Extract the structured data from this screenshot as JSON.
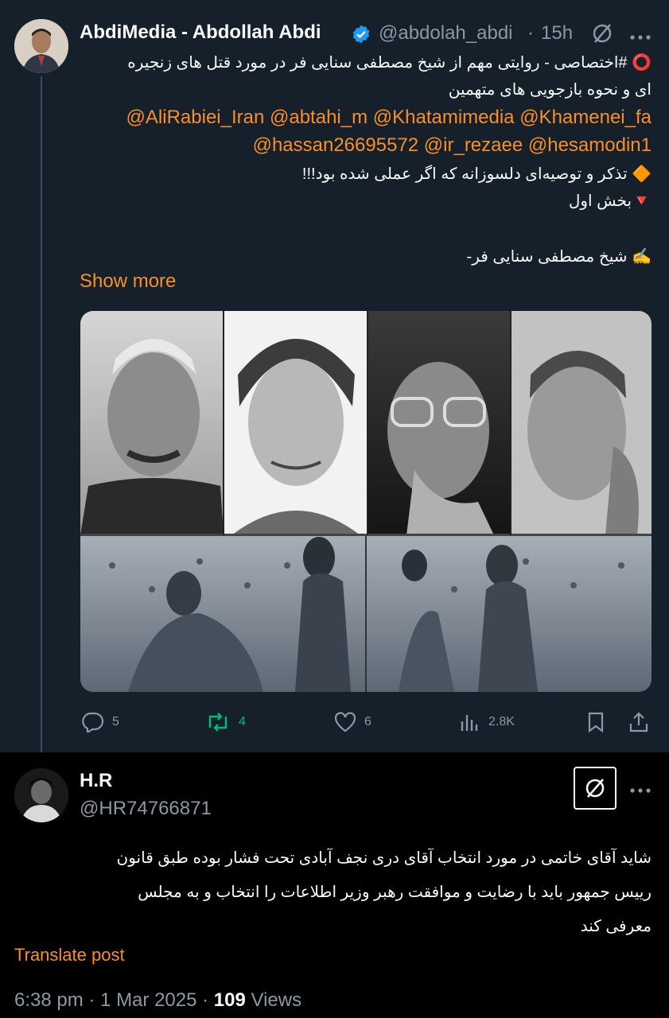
{
  "tweet": {
    "author_name": "AbdiMedia - Abdollah Abdi",
    "handle": "@abdolah_abdi",
    "time": "15h",
    "title_line1": "⭕️ #اختصاصی - روایتی مهم از شیخ مصطفی سنایی فر در مورد قتل های زنجیره",
    "title_line2": "ای و نحوه بازجویی های متهمین",
    "mentions_line1": "@AliRabiei_Iran @abtahi_m @Khatamimedia @Khamenei_fa",
    "mentions_line2": "@hassan26695572 @ir_rezaee @hesamodin1",
    "bullet1": "🔶 تذکر و توصیه‌ای دلسوزانه که اگر عملی شده بود!!!",
    "bullet2": "🔻بخش اول",
    "signature": "✍️ شیخ مصطفی سنایی فر-",
    "show_more": "Show more",
    "stats": {
      "replies": "5",
      "reposts": "4",
      "likes": "6",
      "views": "2.8K"
    }
  },
  "reply": {
    "author_name": "H.R",
    "handle": "@HR74766871",
    "text_line1": "شاید آقای خاتمی در مورد انتخاب آقای دری نجف آبادی تحت فشار بوده  طبق قانون",
    "text_line2": "رییس جمهور باید با رضایت و موافقت رهبر وزیر اطلاعات را انتخاب و به مجلس",
    "text_line3": "معرفی کند",
    "translate": "Translate post",
    "time": "6:38 pm · 1 Mar 2025 · ",
    "views_count": "109",
    "views_label": " Views"
  },
  "colors": {
    "background": "#15202b",
    "accent": "#f98e2c",
    "muted": "#8b98a5",
    "repost_active": "#00ba7c",
    "verified": "#1d9bf0"
  }
}
